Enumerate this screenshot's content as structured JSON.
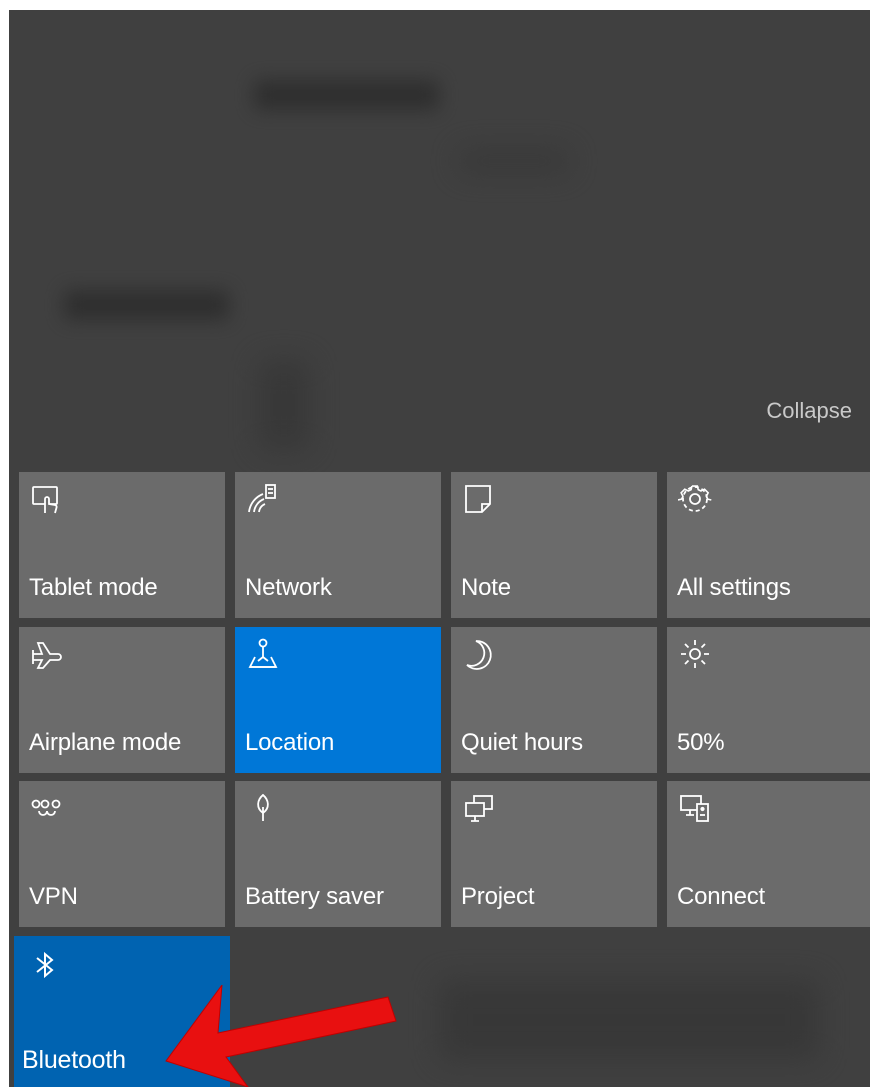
{
  "action_center": {
    "collapse_label": "Collapse",
    "tiles": [
      {
        "label": "Tablet mode",
        "icon": "tablet-mode-icon",
        "state": "off"
      },
      {
        "label": "Network",
        "icon": "network-icon",
        "state": "off"
      },
      {
        "label": "Note",
        "icon": "note-icon",
        "state": "off"
      },
      {
        "label": "All settings",
        "icon": "gear-icon",
        "state": "off"
      },
      {
        "label": "Airplane mode",
        "icon": "airplane-icon",
        "state": "off"
      },
      {
        "label": "Location",
        "icon": "location-icon",
        "state": "on"
      },
      {
        "label": "Quiet hours",
        "icon": "moon-icon",
        "state": "off"
      },
      {
        "label": "50%",
        "icon": "brightness-icon",
        "state": "off"
      },
      {
        "label": "VPN",
        "icon": "vpn-icon",
        "state": "off"
      },
      {
        "label": "Battery saver",
        "icon": "battery-saver-icon",
        "state": "off"
      },
      {
        "label": "Project",
        "icon": "project-icon",
        "state": "off"
      },
      {
        "label": "Connect",
        "icon": "connect-icon",
        "state": "off"
      },
      {
        "label": "Bluetooth",
        "icon": "bluetooth-icon",
        "state": "on"
      }
    ]
  },
  "colors": {
    "panel_background": "#404040",
    "tile_off": "#6b6b6b",
    "tile_active": "#0077d7",
    "tile_bluetooth": "#0063b1",
    "annotation_arrow": "#e81010"
  }
}
